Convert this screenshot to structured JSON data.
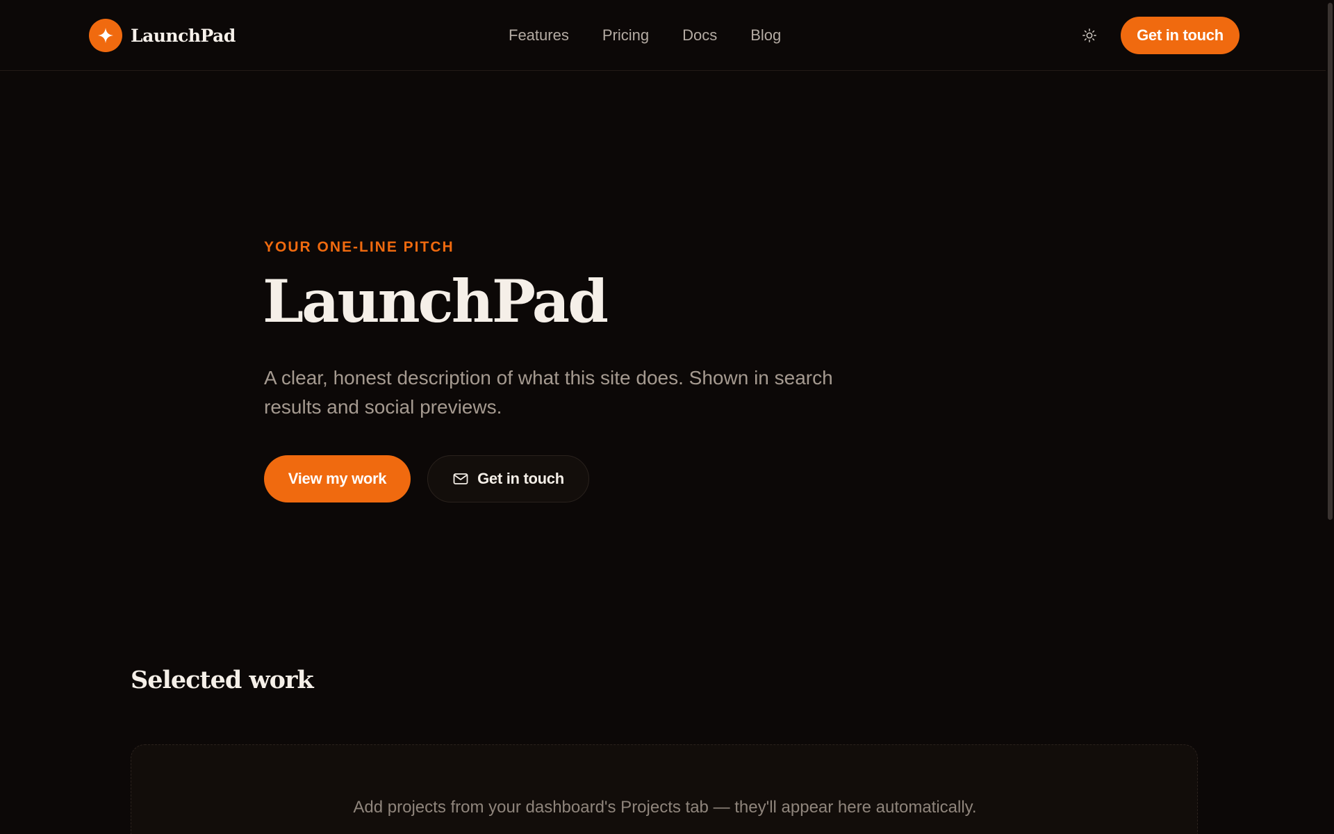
{
  "header": {
    "brand_name": "LaunchPad",
    "nav": [
      "Features",
      "Pricing",
      "Docs",
      "Blog"
    ],
    "cta_label": "Get in touch"
  },
  "hero": {
    "eyebrow": "YOUR ONE-LINE PITCH",
    "title": "LaunchPad",
    "description": "A clear, honest description of what this site does. Shown in search results and social previews.",
    "primary_button": "View my work",
    "secondary_button": "Get in touch"
  },
  "work": {
    "title": "Selected work",
    "empty_message": "Add projects from your dashboard's Projects tab — they'll appear here automatically."
  },
  "icons": {
    "brand": "sparkle-icon",
    "theme_toggle": "sun-icon",
    "secondary_button": "mail-icon"
  },
  "colors": {
    "accent": "#f06a0f",
    "background": "#0c0807",
    "text": "#f5efe8",
    "muted": "#a59a90"
  }
}
